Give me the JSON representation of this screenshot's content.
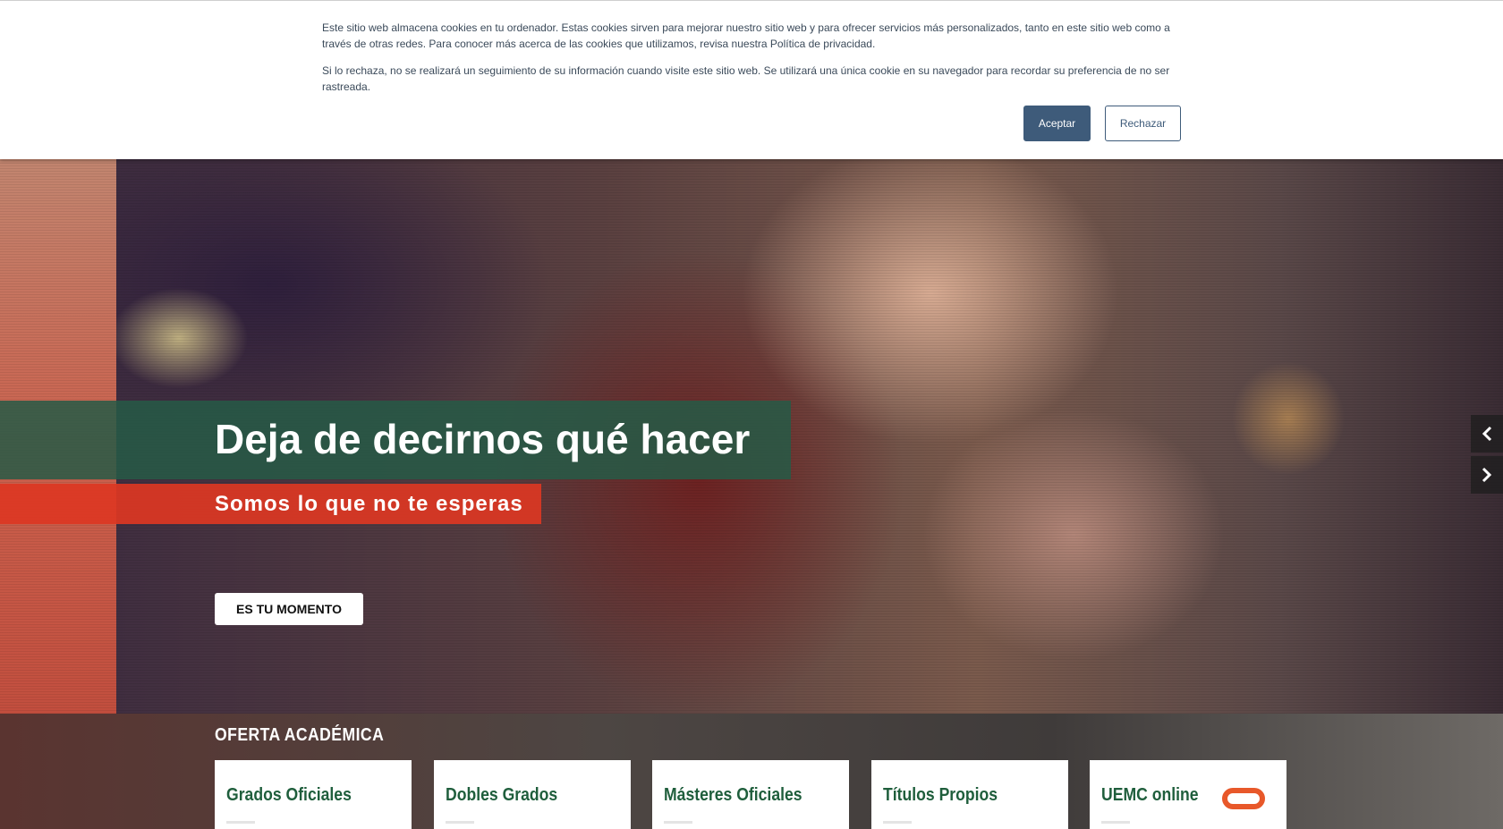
{
  "cookie_banner": {
    "paragraph1": "Este sitio web almacena cookies en tu ordenador. Estas cookies sirven para mejorar nuestro sitio web y para ofrecer servicios más personalizados, tanto en este sitio web como a través de otras redes. Para conocer más acerca de las cookies que utilizamos, revisa nuestra Política de privacidad.",
    "paragraph2": "Si lo rechaza, no se realizará un seguimiento de su información cuando visite este sitio web. Se utilizará una única cookie en su navegador para recordar su preferencia de no ser rastreada.",
    "accept_label": "Aceptar",
    "reject_label": "Rechazar"
  },
  "hero": {
    "title": "Deja de decirnos qué hacer",
    "subtitle": "Somos lo que no te esperas",
    "cta_label": "ES TU MOMENTO",
    "prev_icon": "chevron-left-icon",
    "next_icon": "chevron-right-icon"
  },
  "oferta": {
    "heading": "OFERTA ACADÉMICA",
    "cards": [
      {
        "label": "Grados Oficiales"
      },
      {
        "label": "Dobles Grados"
      },
      {
        "label": "Másteres Oficiales"
      },
      {
        "label": "Títulos Propios"
      },
      {
        "label": "UEMC online",
        "icon": "uemc-online-logo-icon"
      }
    ]
  },
  "colors": {
    "accent_green": "#1f5e3c",
    "accent_red": "#dc3723",
    "button_blue": "#3e5b7a"
  }
}
